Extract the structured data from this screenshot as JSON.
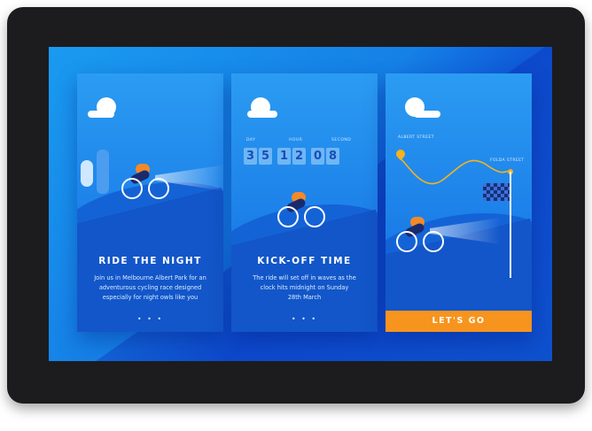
{
  "screens": [
    {
      "title": "RIDE THE NIGHT",
      "description_lines": [
        "Join us in Melbourne Albert Park for an",
        "adventurous cycling race designed",
        "especially for night owls like you"
      ],
      "pager": "• • •"
    },
    {
      "title": "KICK-OFF TIME",
      "countdown": {
        "labels": [
          "DAY",
          "HOUR",
          "SECOND"
        ],
        "digits": [
          "3",
          "5",
          "1",
          "2",
          "0",
          "8"
        ]
      },
      "description_lines": [
        "The ride will set off in waves as the",
        "clock hits midnight on Sunday",
        "28th March"
      ],
      "pager": "• • •"
    },
    {
      "start_label": "ALBERT STREET",
      "finish_label": "FOLDA STREET",
      "cta_label": "LET'S GO"
    }
  ],
  "colors": {
    "bezel": "#1c1c1e",
    "screen_blue": "#1580e6",
    "accent_orange": "#f7941e"
  }
}
